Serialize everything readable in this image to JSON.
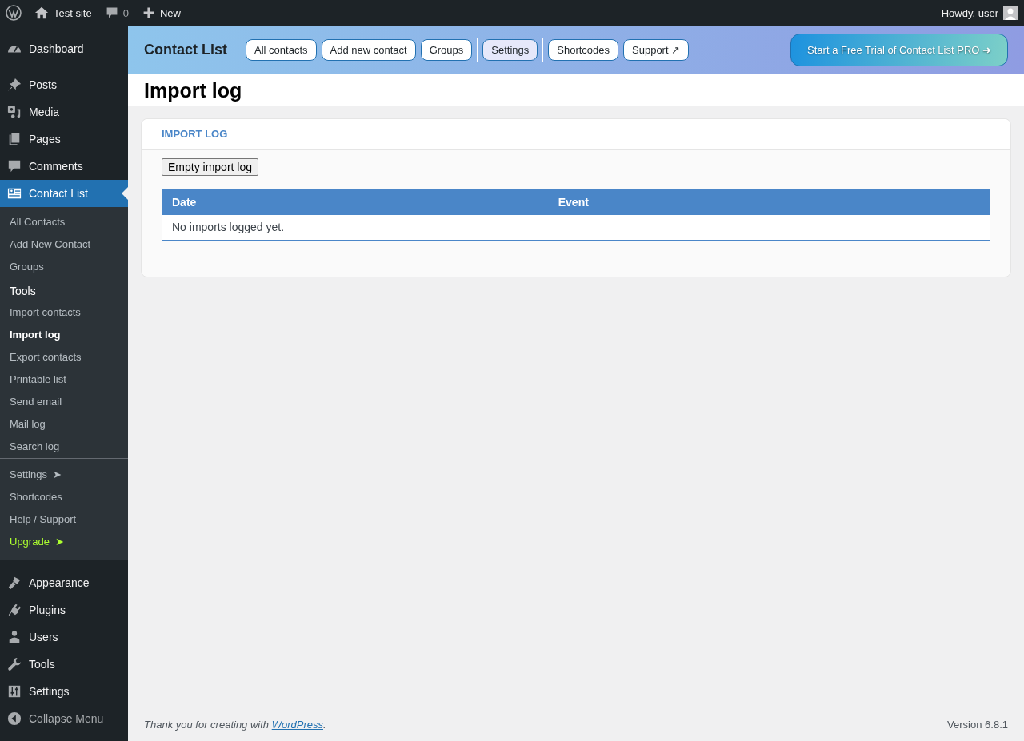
{
  "admin_bar": {
    "site": "Test site",
    "comments": "0",
    "new": "New",
    "greeting": "Howdy, user"
  },
  "sidebar": {
    "items_top": [
      {
        "label": "Dashboard",
        "selected": false
      },
      {
        "label": "Posts",
        "selected": false
      },
      {
        "label": "Media",
        "selected": false
      },
      {
        "label": "Pages",
        "selected": false
      },
      {
        "label": "Comments",
        "selected": false
      },
      {
        "label": "Contact List",
        "selected": true
      }
    ],
    "submenu": [
      {
        "items": [
          {
            "label": "All Contacts",
            "kind": "link",
            "selected": false
          },
          {
            "label": "Add New Contact",
            "kind": "link",
            "selected": false
          },
          {
            "label": "Groups",
            "kind": "link",
            "selected": false
          }
        ]
      },
      {
        "heading": "Tools",
        "items": [
          {
            "label": "Import contacts",
            "kind": "link",
            "selected": false
          },
          {
            "label": "Import log",
            "kind": "link",
            "selected": true
          },
          {
            "label": "Export contacts",
            "kind": "link",
            "selected": false
          },
          {
            "label": "Printable list",
            "kind": "link",
            "selected": false
          },
          {
            "label": "Send email",
            "kind": "link",
            "selected": false
          },
          {
            "label": "Mail log",
            "kind": "link",
            "selected": false
          },
          {
            "label": "Search log",
            "kind": "link",
            "selected": false
          }
        ]
      },
      {
        "items": [
          {
            "label": "Settings",
            "arrow": "➤",
            "kind": "link",
            "selected": false
          },
          {
            "label": "Shortcodes",
            "kind": "link",
            "selected": false
          },
          {
            "label": "Help / Support",
            "kind": "link",
            "selected": false
          },
          {
            "label": "Upgrade",
            "arrow": "➤",
            "kind": "upgrade",
            "selected": false
          }
        ]
      }
    ],
    "items_bottom": [
      {
        "label": "Appearance",
        "selected": false
      },
      {
        "label": "Plugins",
        "selected": false
      },
      {
        "label": "Users",
        "selected": false
      },
      {
        "label": "Tools",
        "selected": false
      },
      {
        "label": "Settings",
        "selected": false
      }
    ],
    "collapse": "Collapse Menu"
  },
  "plugin_header": {
    "title": "Contact List",
    "tabs": [
      {
        "label": "All contacts",
        "selected": false
      },
      {
        "label": "Add new contact",
        "selected": false
      },
      {
        "label": "Groups",
        "selected": false
      },
      {
        "label": "Settings",
        "selected": true
      },
      {
        "label": "Shortcodes",
        "selected": false
      },
      {
        "label": "Support ↗",
        "selected": false
      }
    ],
    "promo": "Start a Free Trial of Contact List PRO ➜"
  },
  "page_title": "Import log",
  "card": {
    "title": "IMPORT LOG",
    "button": "Empty import log",
    "table": {
      "columns": [
        "Date",
        "Event"
      ],
      "empty_message": "No imports logged yet."
    }
  },
  "footer": {
    "text": "Thank you for creating with",
    "link": "WordPress",
    "after": ".",
    "version": "Version 6.8.1"
  }
}
